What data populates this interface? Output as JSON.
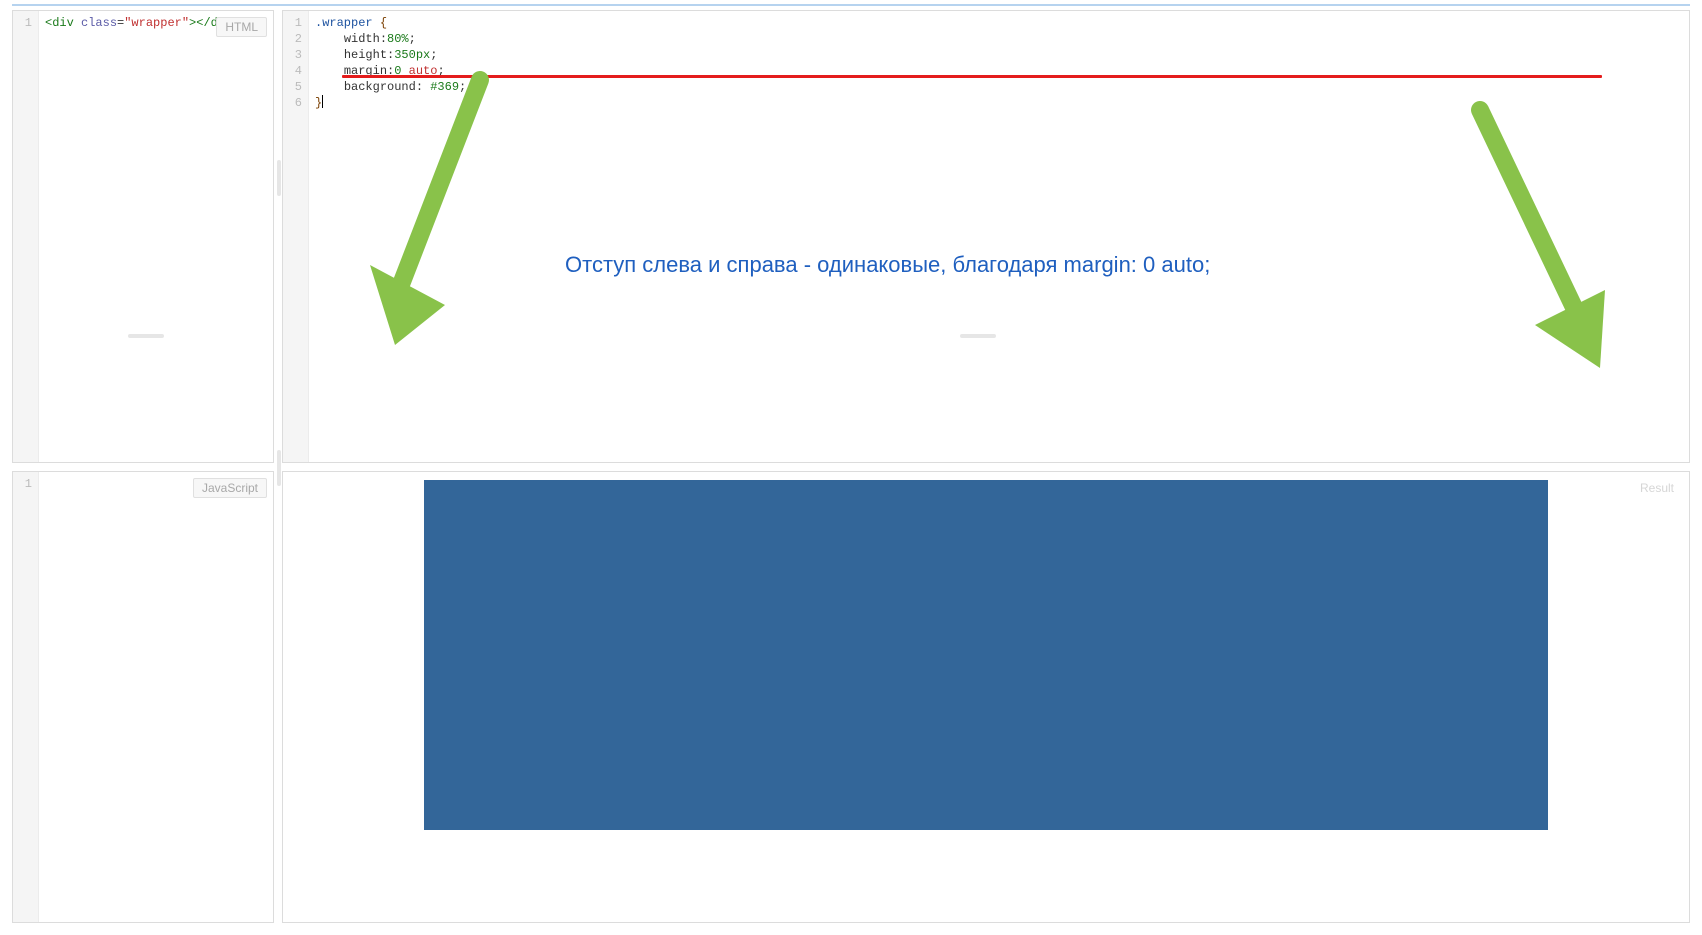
{
  "panels": {
    "html_label": "HTML",
    "js_label": "JavaScript",
    "result_label": "Result"
  },
  "html_editor": {
    "line_numbers": [
      "1"
    ],
    "code": {
      "open_div": "<div",
      "attr_class": "class",
      "eq": "=",
      "val_wrapper": "\"wrapper\"",
      "close_open": ">",
      "close_div": "</div>"
    }
  },
  "css_editor": {
    "line_numbers": [
      "1",
      "2",
      "3",
      "4",
      "5",
      "6"
    ],
    "lines": {
      "selector": ".wrapper",
      "brace_open": "{",
      "width_prop": "width",
      "width_val": "80%",
      "height_prop": "height",
      "height_val": "350px",
      "margin_prop": "margin",
      "margin_zero": "0",
      "margin_auto": "auto",
      "bg_prop": "background",
      "bg_val": "#369",
      "brace_close": "}",
      "semi": ";",
      "colon": ":"
    }
  },
  "js_editor": {
    "line_numbers": [
      "1"
    ]
  },
  "annotation": {
    "text": "Отступ слева и справа - одинаковые, благодаря margin: 0 auto;"
  },
  "colors": {
    "arrow": "#89c24a",
    "underline": "#e41c1c",
    "annotation_text": "#1f5fbf",
    "demo_bg": "#336699"
  }
}
